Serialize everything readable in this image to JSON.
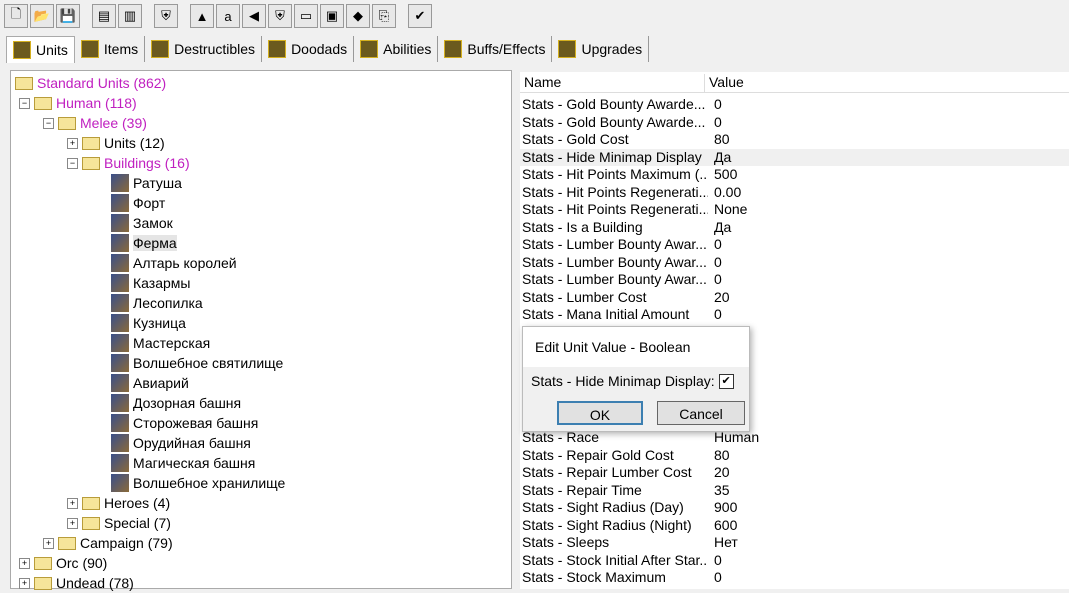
{
  "toolbar": {
    "icons": [
      "new-icon",
      "open-icon",
      "save-icon",
      "copy-icon",
      "paste-icon",
      "unit-editor-icon",
      "terrain-icon",
      "text-icon",
      "sound-icon",
      "object-editor-icon",
      "campaign-icon",
      "ai-icon",
      "import-icon",
      "export-icon",
      "test-map-icon"
    ]
  },
  "tabs": [
    {
      "label": "Units"
    },
    {
      "label": "Items"
    },
    {
      "label": "Destructibles"
    },
    {
      "label": "Doodads"
    },
    {
      "label": "Abilities"
    },
    {
      "label": "Buffs/Effects"
    },
    {
      "label": "Upgrades"
    }
  ],
  "tree": {
    "root": "Standard Units (862)",
    "human": "Human (118)",
    "melee": "Melee (39)",
    "units": "Units (12)",
    "buildings": "Buildings (16)",
    "buildings_list": [
      "Ратуша",
      "Форт",
      "Замок",
      "Ферма",
      "Алтарь королей",
      "Казармы",
      "Лесопилка",
      "Кузница",
      "Мастерская",
      "Волшебное святилище",
      "Авиарий",
      "Дозорная башня",
      "Сторожевая башня",
      "Орудийная башня",
      "Магическая башня",
      "Волшебное хранилище"
    ],
    "heroes": "Heroes (4)",
    "special": "Special (7)",
    "campaign": "Campaign (79)",
    "orc": "Orc (90)",
    "undead": "Undead (78)"
  },
  "list": {
    "col_name": "Name",
    "col_value": "Value",
    "rows_top": [
      [
        "Stats - Gold Bounty Awarde...",
        "0"
      ],
      [
        "Stats - Gold Bounty Awarde...",
        "0"
      ],
      [
        "Stats - Gold Cost",
        "80"
      ],
      [
        "Stats - Hide Minimap Display",
        "Да"
      ],
      [
        "Stats - Hit Points Maximum (...",
        "500"
      ],
      [
        "Stats - Hit Points Regenerati...",
        "0.00"
      ],
      [
        "Stats - Hit Points Regenerati...",
        "None"
      ],
      [
        "Stats - Is a Building",
        "Да"
      ],
      [
        "Stats - Lumber Bounty Awar...",
        "0"
      ],
      [
        "Stats - Lumber Bounty Awar...",
        "0"
      ],
      [
        "Stats - Lumber Bounty Awar...",
        "0"
      ],
      [
        "Stats - Lumber Cost",
        "20"
      ],
      [
        "Stats - Mana Initial Amount",
        "0"
      ]
    ],
    "rows_bottom": [
      [
        "Stats - Race",
        "Human"
      ],
      [
        "Stats - Repair Gold Cost",
        "80"
      ],
      [
        "Stats - Repair Lumber Cost",
        "20"
      ],
      [
        "Stats - Repair Time",
        "35"
      ],
      [
        "Stats - Sight Radius (Day)",
        "900"
      ],
      [
        "Stats - Sight Radius (Night)",
        "600"
      ],
      [
        "Stats - Sleeps",
        "Нет"
      ],
      [
        "Stats - Stock Initial After Star...",
        "0"
      ],
      [
        "Stats - Stock Maximum",
        "0"
      ]
    ]
  },
  "dialog": {
    "title": "Edit Unit Value - Boolean",
    "field_label": "Stats - Hide Minimap Display:",
    "checked": true,
    "check_mark": "✔",
    "ok": "OK",
    "cancel": "Cancel"
  }
}
